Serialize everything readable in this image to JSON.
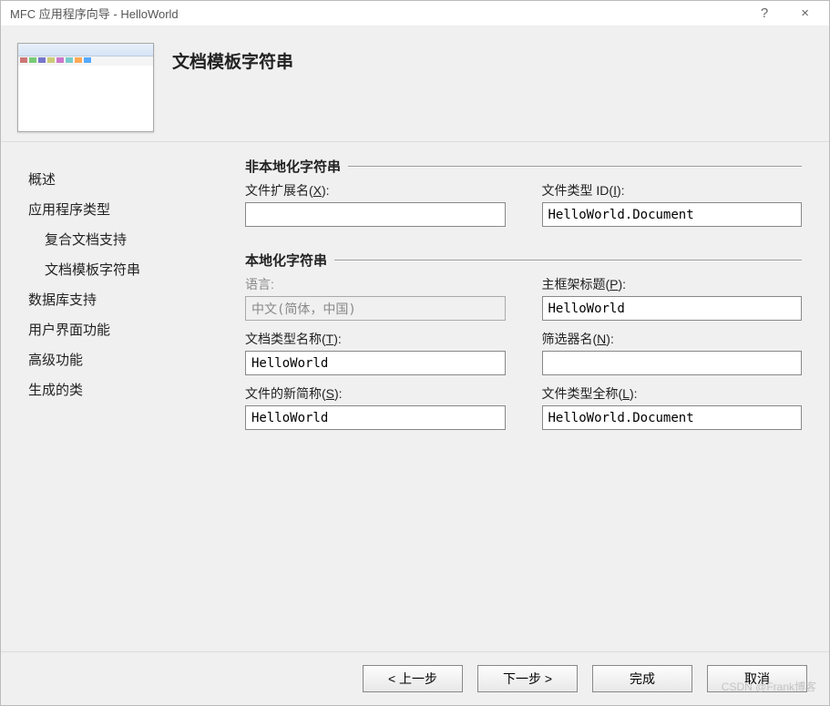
{
  "window": {
    "title": "MFC 应用程序向导 - HelloWorld",
    "help": "?",
    "close": "×"
  },
  "header": {
    "heading": "文档模板字符串"
  },
  "sidebar": {
    "items": [
      {
        "label": "概述",
        "indent": false
      },
      {
        "label": "应用程序类型",
        "indent": false
      },
      {
        "label": "复合文档支持",
        "indent": true
      },
      {
        "label": "文档模板字符串",
        "indent": true
      },
      {
        "label": "数据库支持",
        "indent": false
      },
      {
        "label": "用户界面功能",
        "indent": false
      },
      {
        "label": "高级功能",
        "indent": false
      },
      {
        "label": "生成的类",
        "indent": false
      }
    ]
  },
  "groups": {
    "nonlocalized": {
      "title": "非本地化字符串",
      "file_ext_label": "文件扩展名(X):",
      "file_ext_value": "",
      "file_type_id_label": "文件类型 ID(I):",
      "file_type_id_value": "HelloWorld.Document"
    },
    "localized": {
      "title": "本地化字符串",
      "language_label": "语言:",
      "language_value": "中文(简体，中国)",
      "mainframe_label": "主框架标题(P):",
      "mainframe_value": "HelloWorld",
      "doctype_label": "文档类型名称(T):",
      "doctype_value": "HelloWorld",
      "filter_label": "筛选器名(N):",
      "filter_value": "",
      "newshort_label": "文件的新简称(S):",
      "newshort_value": "HelloWorld",
      "filetype_full_label": "文件类型全称(L):",
      "filetype_full_value": "HelloWorld.Document"
    }
  },
  "buttons": {
    "prev": "< 上一步",
    "next": "下一步 >",
    "finish": "完成",
    "cancel": "取消"
  },
  "watermark": "CSDN @Frank博客"
}
